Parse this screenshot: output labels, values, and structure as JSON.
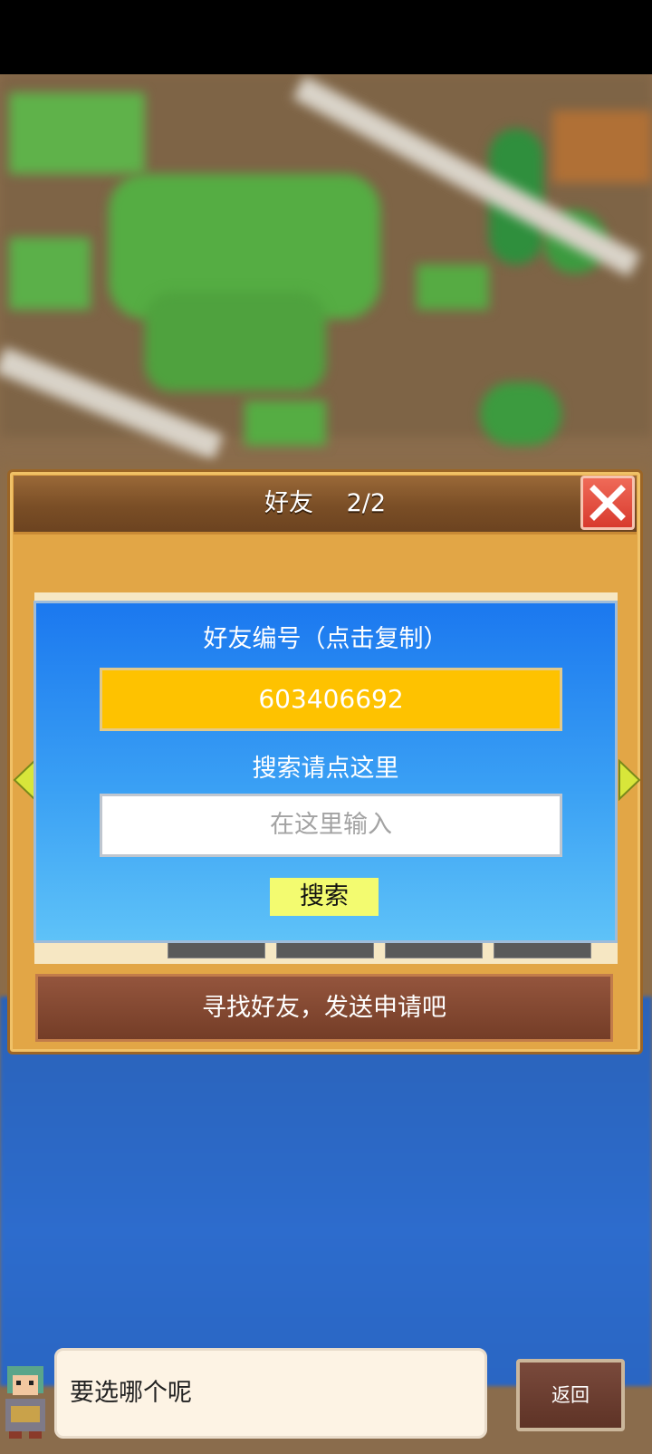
{
  "dialog": {
    "title": "好友",
    "count": "2/2",
    "close_icon": "close-icon"
  },
  "friend_id": {
    "label": "好友编号（点击复制）",
    "value": "603406692",
    "accent_color": "#fec200"
  },
  "search": {
    "label": "搜索请点这里",
    "placeholder": "在这里输入",
    "button_label": "搜索"
  },
  "find_button_label": "寻找好友，发送申请吧",
  "speech": {
    "text": "要选哪个呢"
  },
  "back_button_label": "返回"
}
